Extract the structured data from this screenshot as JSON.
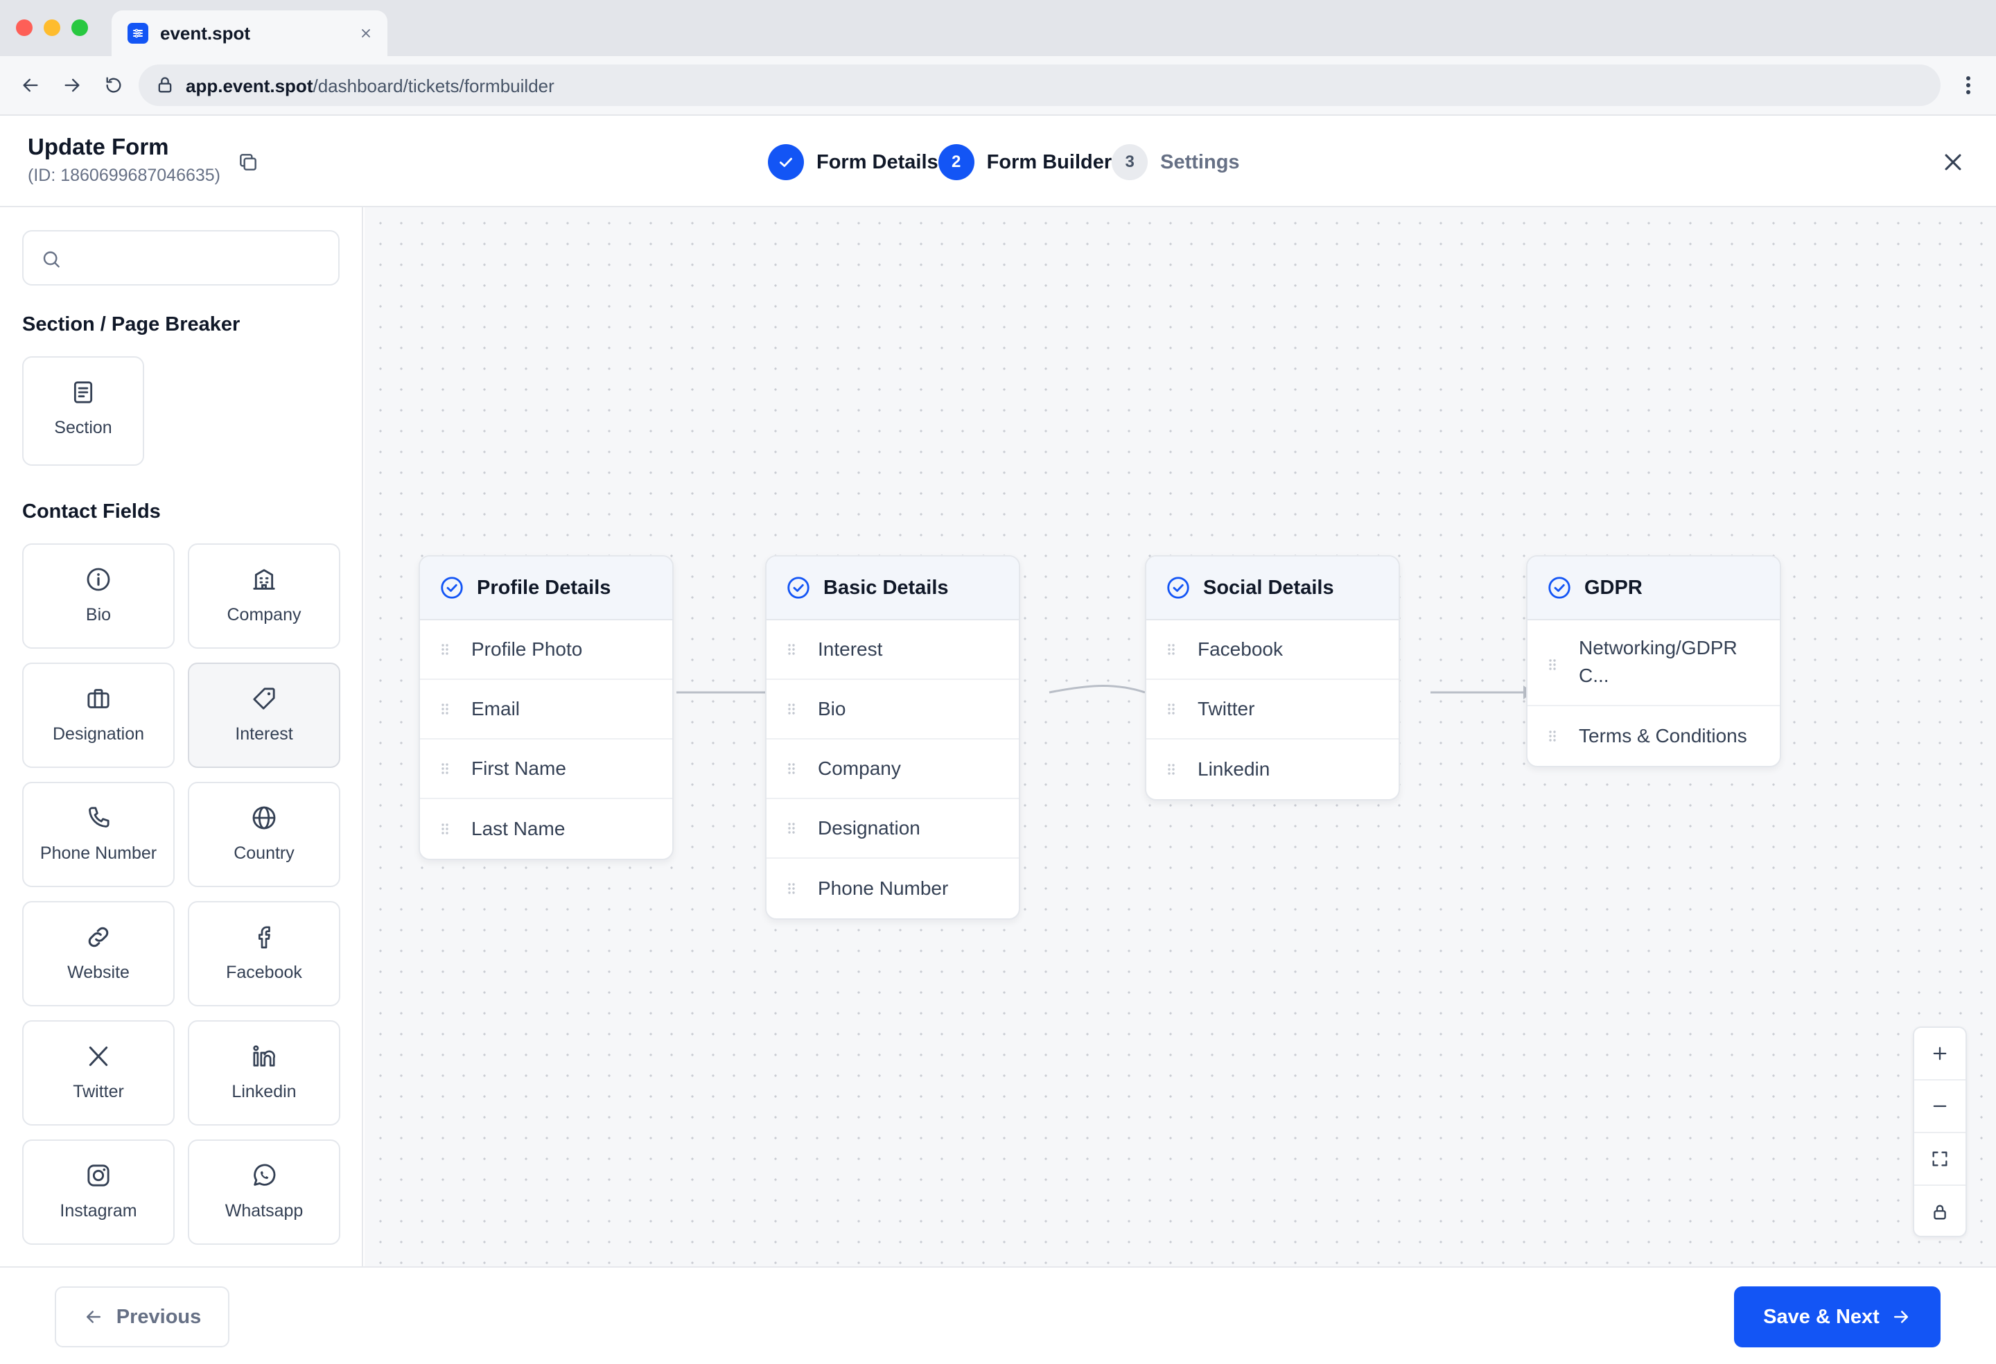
{
  "browser": {
    "tab_title": "event.spot",
    "url_host": "app.event.spot",
    "url_path": "/dashboard/tickets/formbuilder"
  },
  "header": {
    "title": "Update Form",
    "form_id": "(ID: 1860699687046635)",
    "steps": [
      {
        "number": "",
        "label": "Form Details",
        "state": "done"
      },
      {
        "number": "2",
        "label": "Form Builder",
        "state": "active"
      },
      {
        "number": "3",
        "label": "Settings",
        "state": "todo"
      }
    ]
  },
  "sidebar": {
    "search_placeholder": "",
    "section_group_title": "Section / Page Breaker",
    "section_item": {
      "label": "Section",
      "icon": "document-icon"
    },
    "contact_group_title": "Contact Fields",
    "contact_fields": [
      {
        "label": "Bio",
        "icon": "info-icon"
      },
      {
        "label": "Company",
        "icon": "building-icon"
      },
      {
        "label": "Designation",
        "icon": "briefcase-icon"
      },
      {
        "label": "Interest",
        "icon": "tag-icon"
      },
      {
        "label": "Phone Number",
        "icon": "phone-icon"
      },
      {
        "label": "Country",
        "icon": "globe-icon"
      },
      {
        "label": "Website",
        "icon": "link-icon"
      },
      {
        "label": "Facebook",
        "icon": "facebook-icon"
      },
      {
        "label": "Twitter",
        "icon": "x-twitter-icon"
      },
      {
        "label": "Linkedin",
        "icon": "linkedin-icon"
      },
      {
        "label": "Instagram",
        "icon": "instagram-icon"
      },
      {
        "label": "Whatsapp",
        "icon": "whatsapp-icon"
      }
    ]
  },
  "canvas": {
    "nodes": [
      {
        "title": "Profile Details",
        "fields": [
          "Profile Photo",
          "Email",
          "First Name",
          "Last Name"
        ]
      },
      {
        "title": "Basic Details",
        "fields": [
          "Interest",
          "Bio",
          "Company",
          "Designation",
          "Phone Number"
        ]
      },
      {
        "title": "Social Details",
        "fields": [
          "Facebook",
          "Twitter",
          "Linkedin"
        ]
      },
      {
        "title": "GDPR",
        "fields": [
          "Networking/GDPR C...",
          "Terms & Conditions"
        ]
      }
    ],
    "zoom_controls": [
      "zoom-in",
      "zoom-out",
      "fit-view",
      "lock"
    ]
  },
  "footer": {
    "previous_label": "Previous",
    "next_label": "Save & Next"
  },
  "colors": {
    "primary": "#1355f5",
    "canvas_bg": "#f6f7f9",
    "border": "#e4e7ec"
  }
}
